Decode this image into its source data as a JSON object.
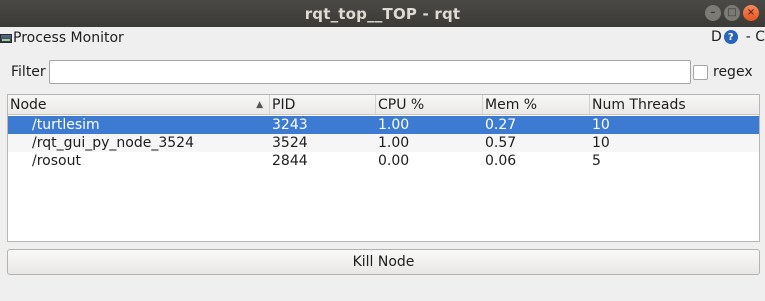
{
  "window": {
    "title": "rqt_top__TOP - rqt"
  },
  "plugin": {
    "title": "Process Monitor",
    "d_label": "D",
    "help_glyph": "?",
    "right_text": "- C"
  },
  "filter": {
    "label": "Filter",
    "value": "",
    "placeholder": "",
    "regex_label": "regex",
    "regex_checked": false
  },
  "table": {
    "columns": [
      "Node",
      "PID",
      "CPU %",
      "Mem %",
      "Num Threads"
    ],
    "sort_column": "Node",
    "rows": [
      {
        "node": "/turtlesim",
        "pid": "3243",
        "cpu": "1.00",
        "mem": "0.27",
        "threads": "10",
        "selected": true
      },
      {
        "node": "/rqt_gui_py_node_3524",
        "pid": "3524",
        "cpu": "1.00",
        "mem": "0.57",
        "threads": "10",
        "selected": false
      },
      {
        "node": "/rosout",
        "pid": "2844",
        "cpu": "0.00",
        "mem": "0.06",
        "threads": "5",
        "selected": false
      }
    ]
  },
  "actions": {
    "kill_label": "Kill Node"
  },
  "icons": {
    "plugin": "monitor-icon",
    "help": "help-icon",
    "sort": "sort-ascending-icon"
  },
  "colors": {
    "selection": "#3d7bd2",
    "titlebar": "#3b3a36",
    "close": "#e8541e"
  }
}
